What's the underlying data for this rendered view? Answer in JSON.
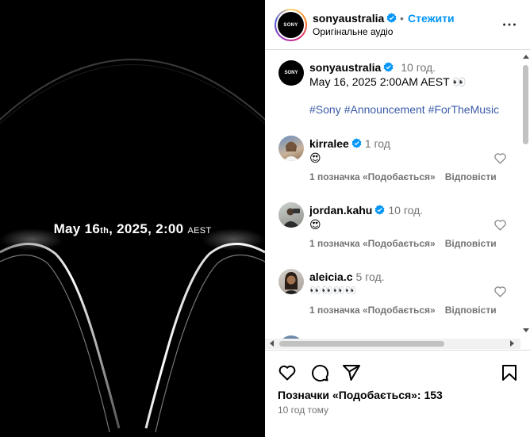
{
  "media": {
    "caption_date": "May 16",
    "caption_th": "th",
    "caption_rest": ", 2025, 2:00",
    "caption_tz": "AEST",
    "background": "#000000"
  },
  "header": {
    "username": "sonyaustralia",
    "separator": "•",
    "follow_label": "Стежити",
    "audio_label": "Оригінальне аудіо",
    "avatar_text": "SONY"
  },
  "caption": {
    "username": "sonyaustralia",
    "time": "10 год.",
    "text": "May 16, 2025 2:00AM AEST 👀",
    "hashtags": [
      "#Sony",
      "#Announcement",
      "#ForTheMusic"
    ]
  },
  "comments": [
    {
      "username": "kirralee",
      "verified": true,
      "time": "1 год",
      "text": "😍",
      "likes_label": "1 позначка «Подобається»",
      "reply_label": "Відповісти"
    },
    {
      "username": "jordan.kahu",
      "verified": true,
      "time": "10 год.",
      "text": "😍",
      "likes_label": "1 позначка «Подобається»",
      "reply_label": "Відповісти"
    },
    {
      "username": "aleicia.c",
      "verified": false,
      "time": "5 год.",
      "text": "👀👀👀👀",
      "likes_label": "1 позначка «Подобається»",
      "reply_label": "Відповісти"
    }
  ],
  "footer": {
    "likes_label": "Позначки «Подобається»: 153",
    "time_ago": "10 год тому"
  },
  "colors": {
    "accent": "#0095f6",
    "verified": "#0095f6",
    "hashtag": "#3a5ba8",
    "muted": "#737373"
  },
  "icons": [
    "verified-icon",
    "more-icon",
    "heart-icon",
    "comment-icon",
    "share-icon",
    "bookmark-icon"
  ]
}
